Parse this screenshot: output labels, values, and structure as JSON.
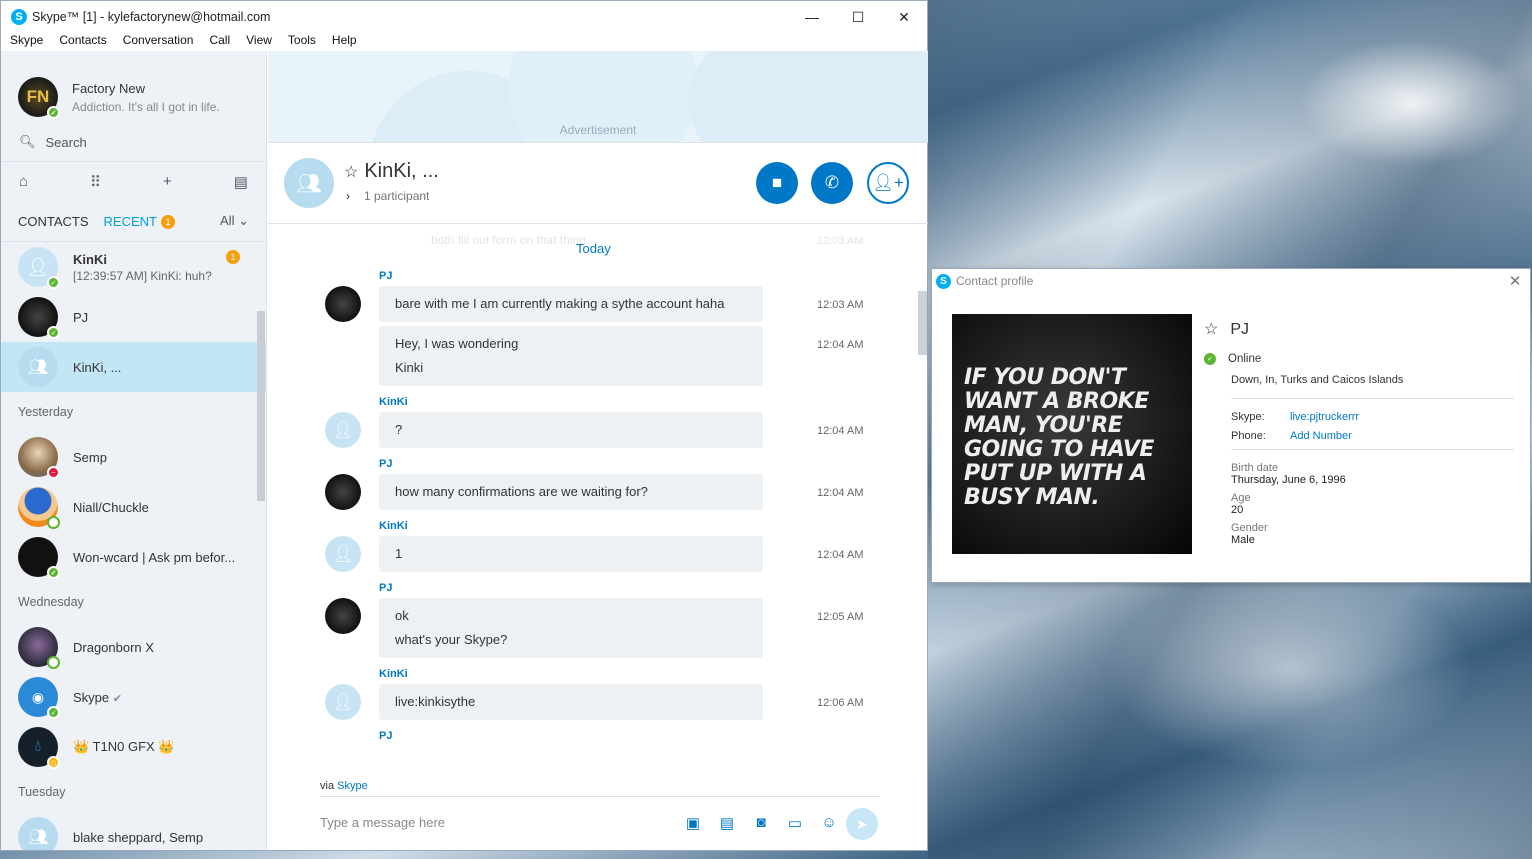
{
  "window": {
    "title": "Skype™ [1] - kylefactorynew@hotmail.com",
    "min": "—",
    "max": "☐",
    "close": "✕"
  },
  "menu": [
    "Skype",
    "Contacts",
    "Conversation",
    "Call",
    "View",
    "Tools",
    "Help"
  ],
  "me": {
    "name": "Factory New",
    "mood": "Addiction. It's all I got in life.",
    "initials": "FN"
  },
  "search": {
    "placeholder": "Search"
  },
  "tabs": {
    "contacts": "CONTACTS",
    "recent": "RECENT",
    "recent_badge": "1",
    "filter": "All"
  },
  "contacts": [
    {
      "name": "KinKi",
      "preview": "[12:39:57 AM] KinKi: huh?",
      "badge": "1"
    },
    {
      "name": "PJ"
    },
    {
      "name": "KinKi, ..."
    }
  ],
  "groups": {
    "yesterday": "Yesterday",
    "wednesday": "Wednesday",
    "tuesday": "Tuesday"
  },
  "yesterday": [
    "Semp",
    "Niall/Chuckle",
    "Won-wcard | Ask pm befor..."
  ],
  "wednesday": [
    "Dragonborn X",
    "Skype",
    "👑 T1N0 GFX 👑"
  ],
  "tuesday": [
    "blake sheppard, Semp"
  ],
  "ad": {
    "label": "Advertisement"
  },
  "chat": {
    "title": "KinKi, ...",
    "participants": "1 participant",
    "faded_msg": "both fill out form on that thing",
    "faded_time": "12:03 AM",
    "today": "Today",
    "messages": [
      {
        "sender": "PJ",
        "lines": [
          "bare with me I am currently making a sythe account haha"
        ],
        "time": "12:03 AM"
      },
      {
        "lines": [
          "Hey, I was wondering",
          "Kinki"
        ],
        "time": "12:04 AM"
      },
      {
        "sender": "KinKi",
        "lines": [
          "?"
        ],
        "time": "12:04 AM"
      },
      {
        "sender": "PJ",
        "lines": [
          "how many confirmations are we waiting for?"
        ],
        "time": "12:04 AM"
      },
      {
        "sender": "KinKi",
        "lines": [
          "1"
        ],
        "time": "12:04 AM"
      },
      {
        "sender": "PJ",
        "lines": [
          "ok",
          "what's your Skype?"
        ],
        "time": "12:05 AM"
      },
      {
        "sender": "KinKi",
        "lines": [
          "live:kinkisythe"
        ],
        "time": "12:06 AM"
      },
      {
        "sender": "PJ"
      }
    ]
  },
  "compose": {
    "via": "via",
    "via_link": "Skype",
    "placeholder": "Type a message here"
  },
  "profile": {
    "window_title": "Contact profile",
    "name": "PJ",
    "status": "Online",
    "location": "Down, In, Turks and Caicos Islands",
    "skype_label": "Skype:",
    "skype": "live:pjtruckerrr",
    "phone_label": "Phone:",
    "phone": "Add Number",
    "birth_label": "Birth date",
    "birth": "Thursday, June 6, 1996",
    "age_label": "Age",
    "age": "20",
    "gender_label": "Gender",
    "gender": "Male",
    "image_text": [
      "IF YOU DON'T",
      "WANT A BROKE",
      "MAN, YOU'RE",
      "GOING TO HAVE",
      "PUT UP WITH A",
      "BUSY MAN."
    ]
  },
  "colors": {
    "accent": "#0078c8",
    "skype_blue": "#00aff0",
    "online": "#5cb531",
    "badge": "#f59f0f"
  }
}
